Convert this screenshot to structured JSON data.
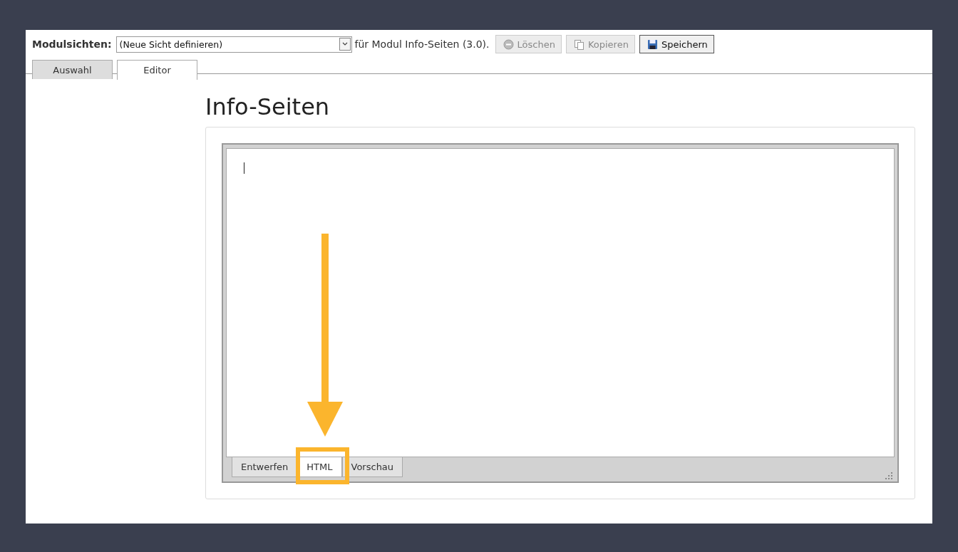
{
  "toolbar": {
    "label": "Modulsichten:",
    "view_select": {
      "value": "(Neue Sicht definieren)"
    },
    "module_text": "für Modul Info-Seiten (3.0).",
    "buttons": [
      {
        "kind": "delete",
        "label": "Löschen",
        "disabled": true
      },
      {
        "kind": "copy",
        "label": "Kopieren",
        "disabled": true
      },
      {
        "kind": "save",
        "label": "Speichern",
        "disabled": false
      }
    ]
  },
  "tabs": [
    {
      "label": "Auswahl",
      "selected": false
    },
    {
      "label": "Editor",
      "selected": true
    }
  ],
  "page_title": "Info-Seiten",
  "editor": {
    "mode_tabs": [
      {
        "label": "Entwerfen",
        "selected": false
      },
      {
        "label": "HTML",
        "selected": true
      },
      {
        "label": "Vorschau",
        "selected": false
      }
    ]
  }
}
